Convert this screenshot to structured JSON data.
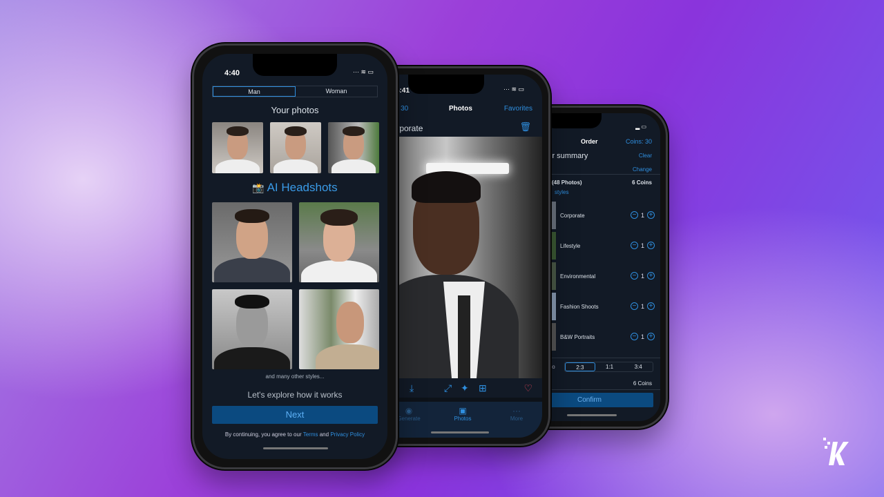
{
  "phone_left": {
    "status_time": "4:40",
    "gender_tabs": [
      {
        "label": "Man",
        "selected": true
      },
      {
        "label": "Woman",
        "selected": false
      }
    ],
    "your_photos_title": "Your photos",
    "headshots_emoji": "📸",
    "headshots_title": "AI Headshots",
    "more_styles": "and many other styles...",
    "explore_text": "Let's explore how it works",
    "next_button": "Next",
    "legal_prefix": "By continuing, you agree to our",
    "terms_link": "Terms",
    "legal_and": "and",
    "privacy_link": "Privacy Policy"
  },
  "phone_middle": {
    "status_time": "4:41",
    "coins_label": "Coins: 30",
    "title": "Photos",
    "favorites_link": "Favorites",
    "style_name": "Corporate",
    "tabs": [
      {
        "label": "Generate",
        "icon": "generate-icon"
      },
      {
        "label": "Photos",
        "icon": "photos-icon",
        "active": true
      },
      {
        "label": "More",
        "icon": "more-icon"
      }
    ]
  },
  "phone_right": {
    "title": "Order",
    "coins_label": "Coins: 30",
    "summary_title": "Order summary",
    "clear_link": "Clear",
    "change_link": "Change",
    "package_label": "(48 Photos)",
    "package_coins": "6 Coins",
    "styles_link": "styles",
    "styles": [
      {
        "name": "Corporate",
        "qty": "1"
      },
      {
        "name": "Lifestyle",
        "qty": "1"
      },
      {
        "name": "Environmental",
        "qty": "1"
      },
      {
        "name": "Fashion Shoots",
        "qty": "1"
      },
      {
        "name": "B&W Portraits",
        "qty": "1"
      }
    ],
    "ratio_label": "Ratio",
    "ratios": [
      {
        "label": "2:3",
        "selected": true
      },
      {
        "label": "1:1"
      },
      {
        "label": "3:4"
      }
    ],
    "total_coins": "6 Coins",
    "confirm_button": "Confirm"
  },
  "colors": {
    "accent": "#2f8fe0",
    "button": "#0b4a80",
    "screen_bg": "#121a26",
    "heart": "#e8455a"
  }
}
